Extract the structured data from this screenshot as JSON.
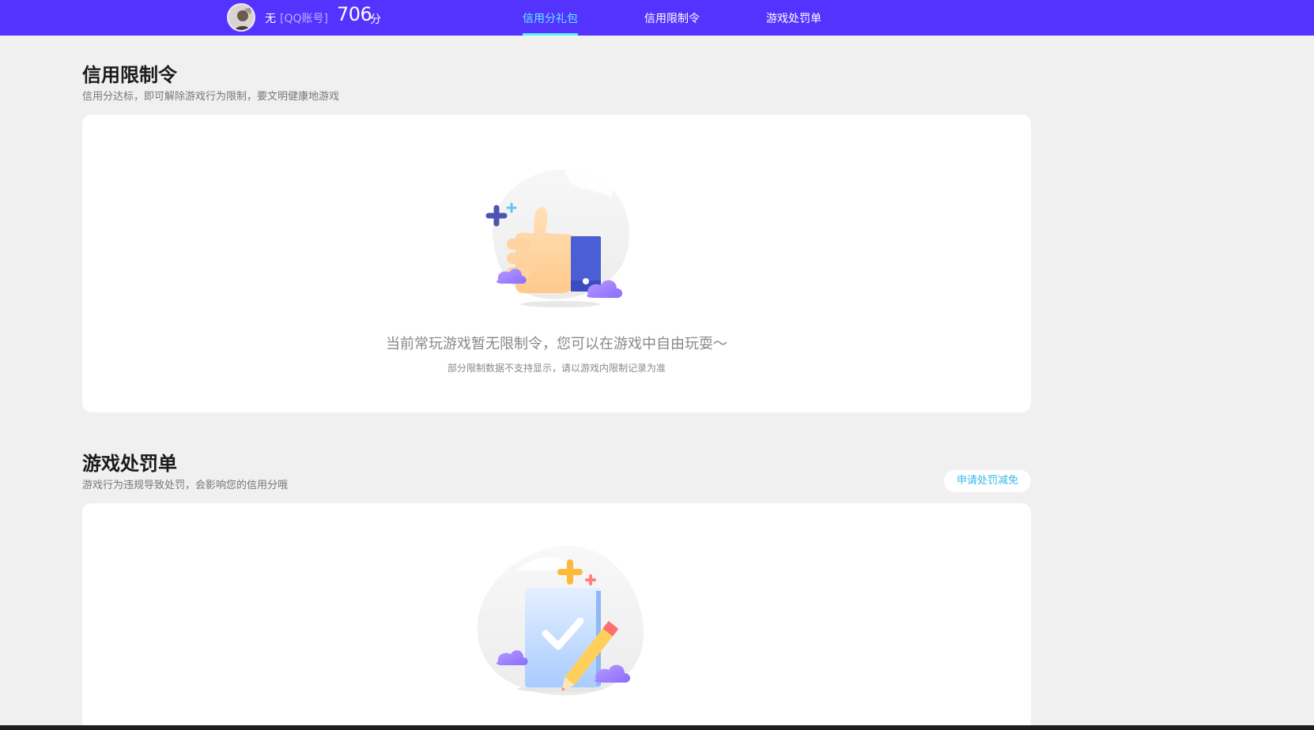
{
  "header": {
    "user_name": "无",
    "account_type": "[QQ账号]",
    "score": "706",
    "score_unit": "分",
    "tabs": [
      {
        "label": "信用分礼包",
        "active": true
      },
      {
        "label": "信用限制令",
        "active": false
      },
      {
        "label": "游戏处罚单",
        "active": false
      }
    ],
    "colors": {
      "bar": "#5533ff",
      "active_tab": "#5ef0ff"
    }
  },
  "restriction": {
    "title": "信用限制令",
    "subtitle": "信用分达标，即可解除游戏行为限制，要文明健康地游戏",
    "empty_message": "当前常玩游戏暂无限制令，您可以在游戏中自由玩耍～",
    "empty_note": "部分限制数据不支持显示，请以游戏内限制记录为准",
    "illustration_icon": "thumbs-up-icon"
  },
  "penalty": {
    "title": "游戏处罚单",
    "subtitle": "游戏行为违规导致处罚，会影响您的信用分哦",
    "appeal_button": "申请处罚减免",
    "illustration_icon": "document-check-icon"
  }
}
